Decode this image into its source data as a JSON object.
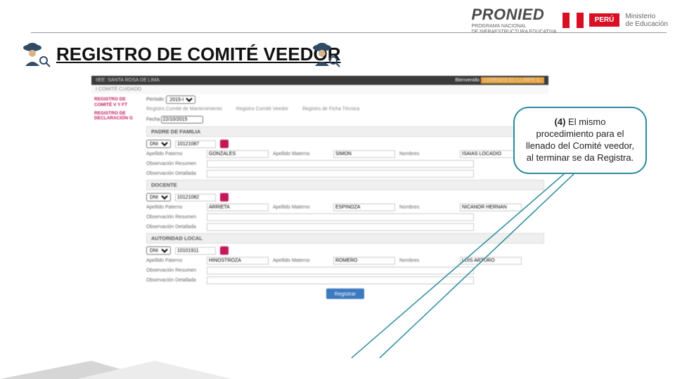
{
  "header": {
    "pronied": "PRONIED",
    "pronied_sub1": "PROGRAMA NACIONAL",
    "pronied_sub2": "DE INFRAESTRUCTURA EDUCATIVA",
    "peru": "PERÚ",
    "ministerio1": "Ministerio",
    "ministerio2": "de Educación"
  },
  "title": "REGISTRO DE COMITÉ VEEDOR",
  "callout": {
    "step": "(4)",
    "text": " El mismo procedimiento para el llenado del Comité veedor, al terminar se da Registra."
  },
  "ss": {
    "topbar_left": "IIEE: SANTA ROSA DE LIMA",
    "welcome": "Bienvenido",
    "user": "LORENZO ELI LLIMPE C.",
    "pink_tab": "I COMITÉ CUIDADO",
    "side1": "REGISTRO DE COMITÉ V Y FT",
    "side2": "REGISTRO DE DECLARACIÓN G",
    "periodo_lbl": "Período:",
    "periodo_val": "2015-I",
    "tabs": [
      "Registro Comité de Mantenimiento",
      "Registro Comité Veedor",
      "Registro de Ficha Técnica"
    ],
    "fecha_lbl": "Fecha",
    "fecha_val": "22/10/2015",
    "sections": [
      {
        "head": "PADRE DE FAMILIA",
        "doc_type": "DNI",
        "doc_num": "10121087",
        "ap_pat": "GONZALES",
        "ap_mat": "SIMON",
        "nombres": "ISAIAS LOCADIO"
      },
      {
        "head": "DOCENTE",
        "doc_type": "DNI",
        "doc_num": "10121082",
        "ap_pat": "ARRIETA",
        "ap_mat": "ESPINOZA",
        "nombres": "NICANOR HERNAN"
      },
      {
        "head": "AUTORIDAD LOCAL",
        "doc_type": "DNI",
        "doc_num": "10101911",
        "ap_pat": "HINOSTROZA",
        "ap_mat": "ROMERO",
        "nombres": "LUIS ARTURO"
      }
    ],
    "lbl_ap_pat": "Apellido Paterno",
    "lbl_ap_mat": "Apellido Materno",
    "lbl_nombres": "Nombres",
    "lbl_obs_res": "Observación Resumen",
    "lbl_obs_det": "Observación Detallada",
    "register": "Registrar"
  }
}
